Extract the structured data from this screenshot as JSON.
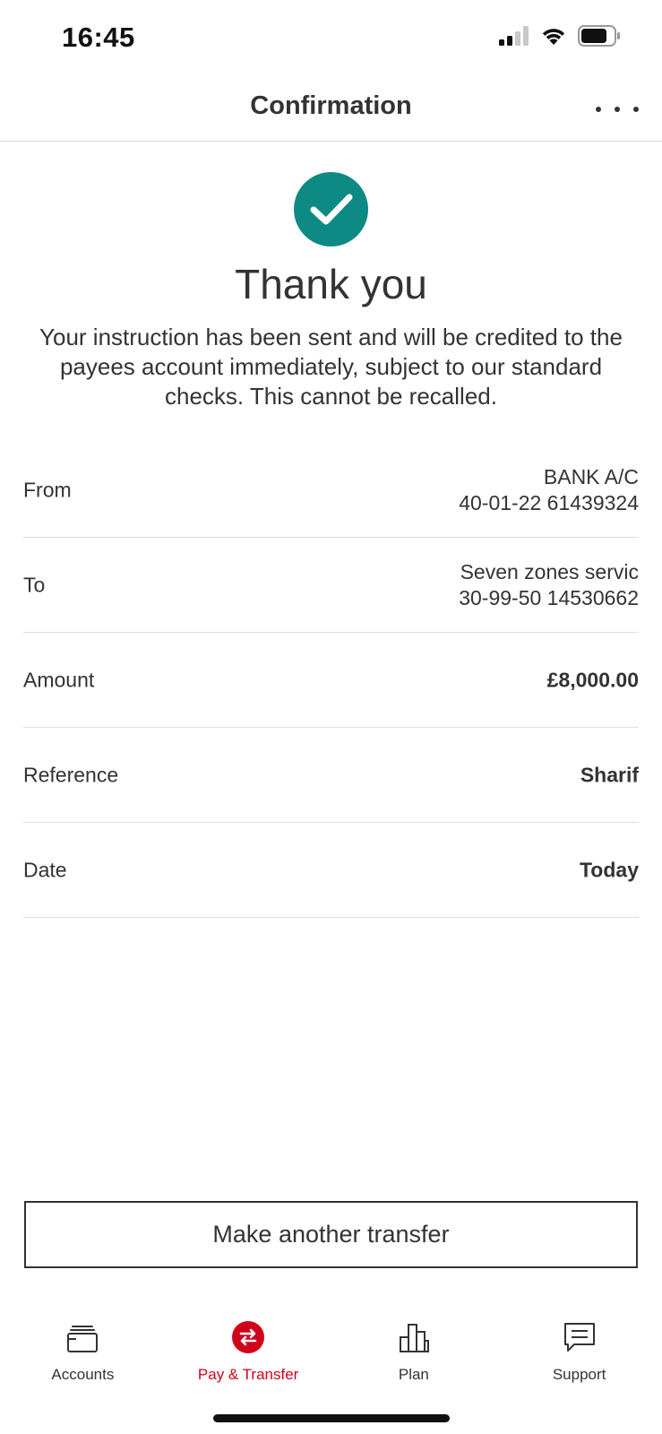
{
  "status_bar": {
    "time": "16:45",
    "icons": [
      "cellular-signal-icon",
      "wifi-icon",
      "battery-icon"
    ]
  },
  "header": {
    "title": "Confirmation",
    "more_icon": "ellipsis-icon"
  },
  "confirmation": {
    "icon": "checkmark-circle-icon",
    "title": "Thank you",
    "message": "Your instruction has been sent and will be credited to the payees account immediately, subject to our standard checks.  This cannot be recalled."
  },
  "details": {
    "from": {
      "label": "From",
      "line1": "BANK A/C",
      "line2": "40-01-22 61439324"
    },
    "to": {
      "label": "To",
      "line1": "Seven zones servic",
      "line2": "30-99-50 14530662"
    },
    "amount": {
      "label": "Amount",
      "value": "£8,000.00"
    },
    "reference": {
      "label": "Reference",
      "value": "Sharif"
    },
    "date": {
      "label": "Date",
      "value": "Today"
    }
  },
  "actions": {
    "another_transfer": "Make another transfer"
  },
  "tab_bar": {
    "accounts": "Accounts",
    "pay_transfer": "Pay & Transfer",
    "plan": "Plan",
    "support": "Support",
    "active": "pay_transfer"
  },
  "colors": {
    "success": "#0e8a84",
    "accent": "#d0021b",
    "text": "#333333",
    "divider": "#dedede"
  }
}
